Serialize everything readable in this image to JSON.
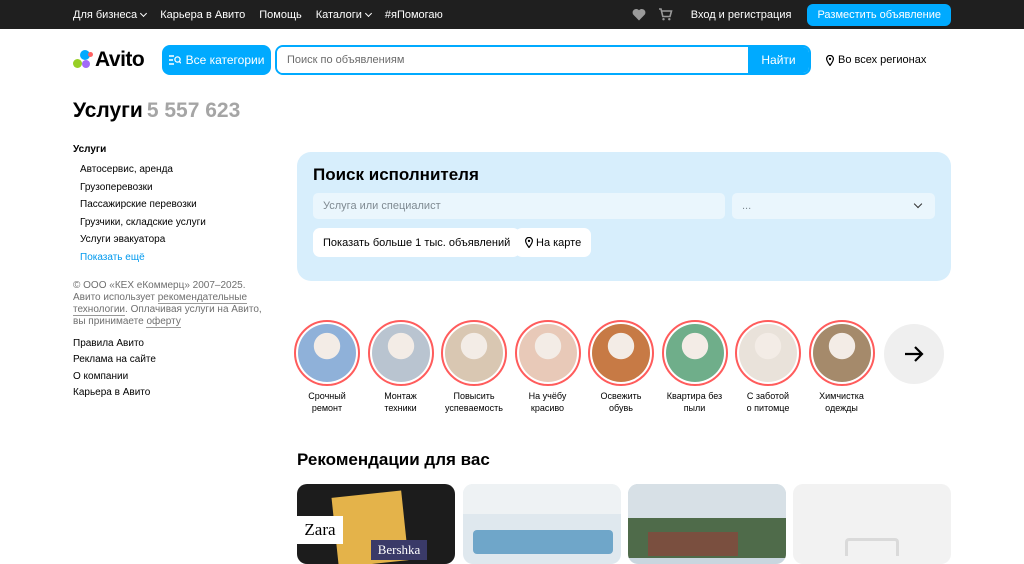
{
  "topbar": {
    "nav": [
      {
        "label": "Для бизнеса",
        "dropdown": true
      },
      {
        "label": "Карьера в Авито",
        "dropdown": false
      },
      {
        "label": "Помощь",
        "dropdown": false
      },
      {
        "label": "Каталоги",
        "dropdown": true
      },
      {
        "label": "#яПомогаю",
        "dropdown": false
      }
    ],
    "icons": [
      "heart-icon",
      "cart-icon"
    ],
    "login": "Вход и регистрация",
    "post_ad": "Разместить объявление"
  },
  "header": {
    "logo": "Avito",
    "categories_button": "Все категории",
    "search_placeholder": "Поиск по объявлениям",
    "search_button": "Найти",
    "region": "Во всех регионах"
  },
  "page": {
    "title": "Услуги",
    "count": "5 557 623"
  },
  "sidebar": {
    "heading": "Услуги",
    "items": [
      "Автосервис, аренда",
      "Грузоперевозки",
      "Пассажирские перевозки",
      "Грузчики, складские услуги",
      "Услуги эвакуатора"
    ],
    "more": "Показать ещё",
    "copyright_1": "© ООО «КЕХ еКоммерц» 2007–2025.",
    "copyright_2": "Авито использует",
    "copyright_link1": "рекомендательные технологии",
    "copyright_3": ". Оплачивая услуги на Авито, вы принимаете",
    "copyright_link2": "оферту",
    "links": [
      "Правила Авито",
      "Реклама на сайте",
      "О компании",
      "Карьера в Авито"
    ]
  },
  "finder": {
    "title": "Поиск исполнителя",
    "service_placeholder": "Услуга или специалист",
    "select_value": "...",
    "show_button": "Показать больше 1 тыс. объявлений",
    "map_button": "На карте"
  },
  "stories": [
    {
      "line1": "Срочный",
      "line2": "ремонт",
      "color": "#8fb1d9"
    },
    {
      "line1": "Монтаж",
      "line2": "техники",
      "color": "#b9c4d0"
    },
    {
      "line1": "Повысить",
      "line2": "успеваемость",
      "color": "#d9c7b2"
    },
    {
      "line1": "На учёбу",
      "line2": "красиво",
      "color": "#e8c9b8"
    },
    {
      "line1": "Освежить",
      "line2": "обувь",
      "color": "#c77a45"
    },
    {
      "line1": "Квартира без",
      "line2": "пыли",
      "color": "#6fae8a"
    },
    {
      "line1": "С заботой",
      "line2": "о питомце",
      "color": "#e9e2da"
    },
    {
      "line1": "Химчистка",
      "line2": "одежды",
      "color": "#a58a6b"
    }
  ],
  "recommendations": {
    "title": "Рекомендации для вас",
    "card1_brand_a": "Zara",
    "card1_brand_b": "Bershka"
  },
  "colors": {
    "accent": "#00aaff",
    "topbar": "#1f1f1f",
    "finder_bg": "#d7eefc",
    "story_ring": "#ff5c5c"
  }
}
